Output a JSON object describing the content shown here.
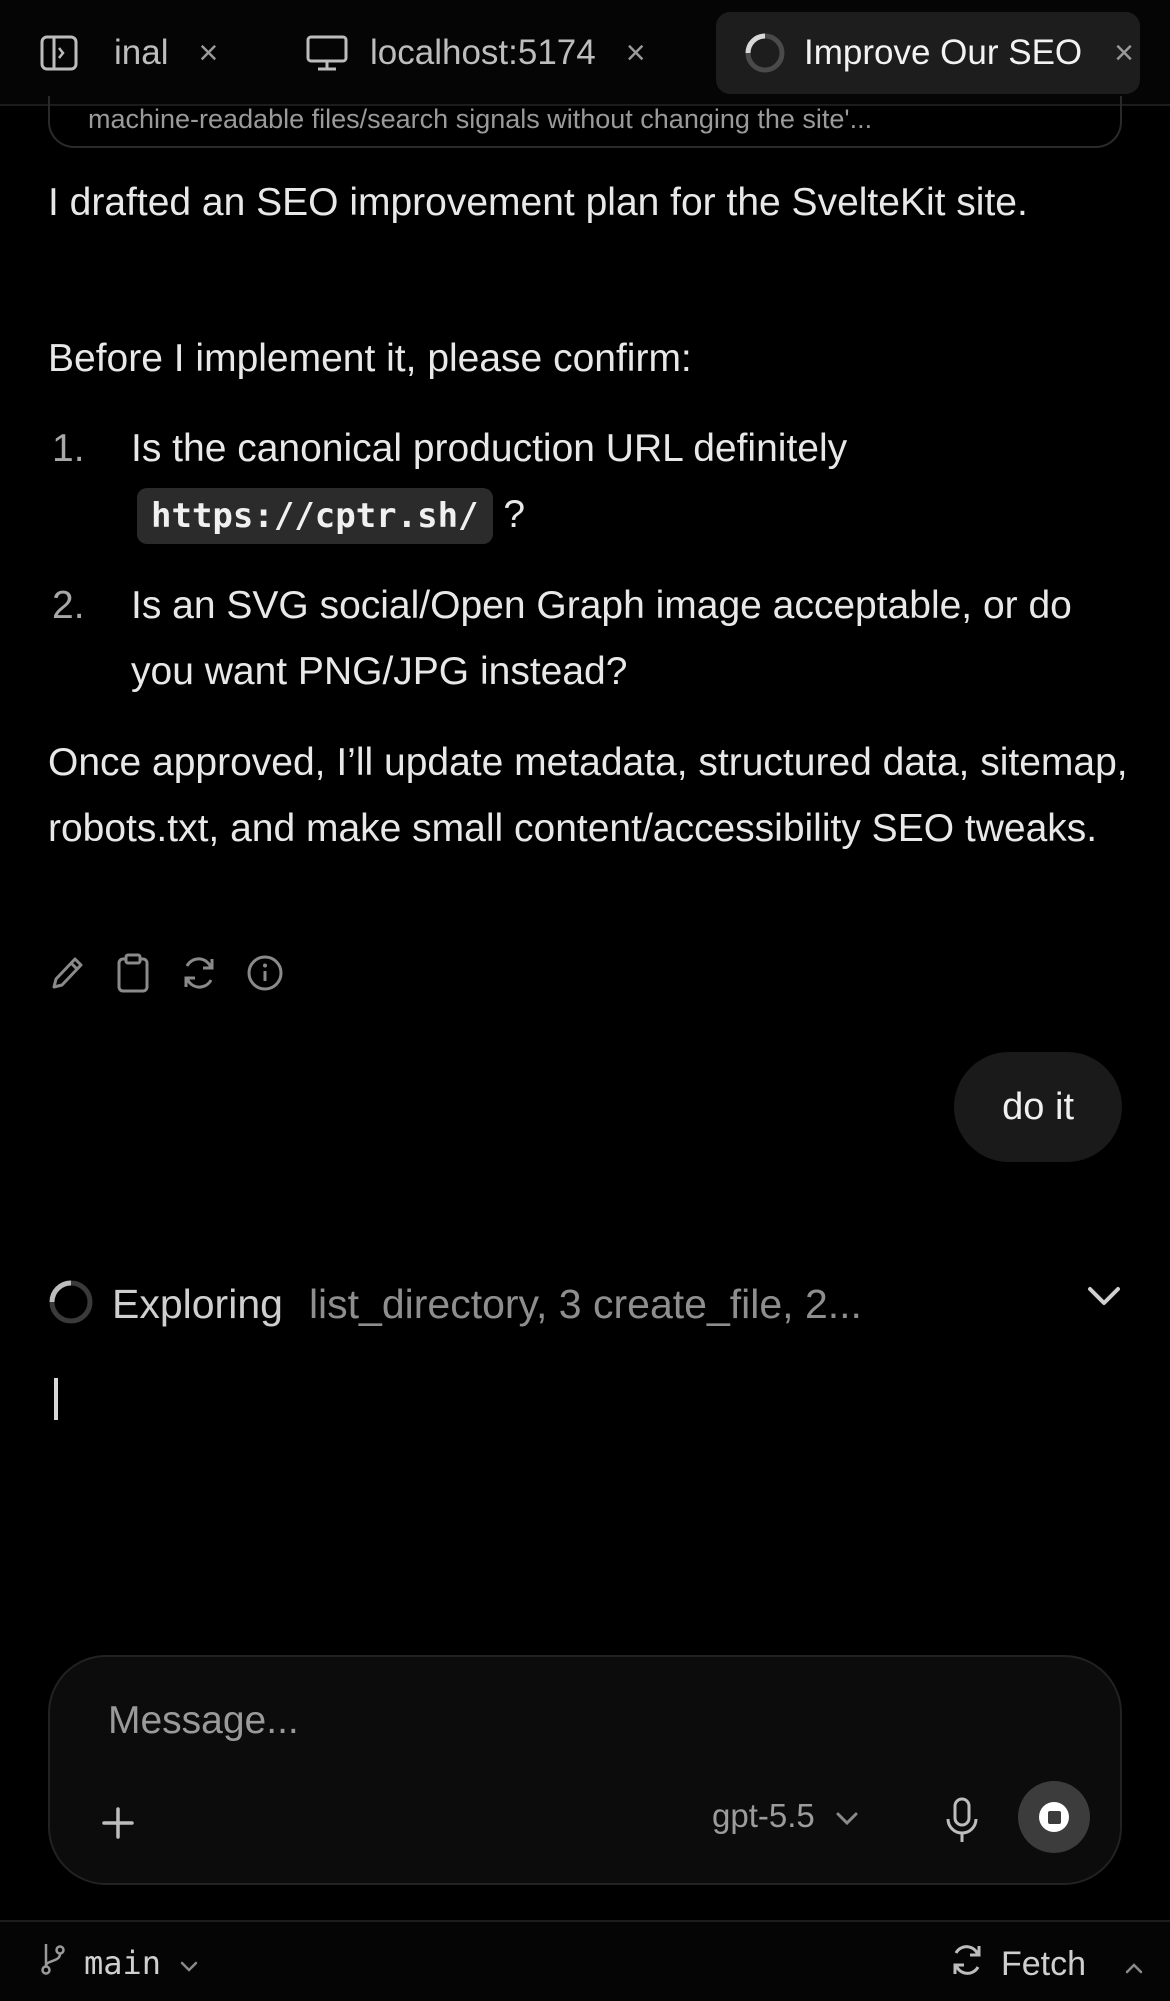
{
  "tabs": [
    {
      "label": "inal",
      "icon": "sidebar-toggle-icon",
      "active": false
    },
    {
      "label": "localhost:5174",
      "icon": "monitor-icon",
      "active": false
    },
    {
      "label": "Improve Our SEO",
      "icon": "loading-spinner-icon",
      "active": true
    }
  ],
  "prev_card_text": "machine-readable files/search signals without changing the site'...",
  "message": {
    "intro": "I drafted an SEO improvement plan for the SvelteKit site.",
    "confirm_prompt": "Before I implement it, please confirm:",
    "items": [
      {
        "num": "1.",
        "text_before": "Is the canonical production URL definitely",
        "code": "https://cptr.sh/",
        "text_after": "?"
      },
      {
        "num": "2.",
        "text": "Is an SVG social/Open Graph image acceptable, or do you want PNG/JPG instead?"
      }
    ],
    "closing": "Once approved, I’ll update metadata, structured data, sitemap, robots.txt, and make small content/accessibility SEO tweaks."
  },
  "message_actions": [
    "pencil-icon",
    "clipboard-icon",
    "refresh-icon",
    "info-icon"
  ],
  "user_message": "do it",
  "exploring": {
    "label": "Exploring",
    "detail": "list_directory, 3 create_file, 2..."
  },
  "composer": {
    "placeholder": "Message...",
    "model": "gpt-5.5"
  },
  "statusbar": {
    "branch": "main",
    "fetch": "Fetch"
  }
}
